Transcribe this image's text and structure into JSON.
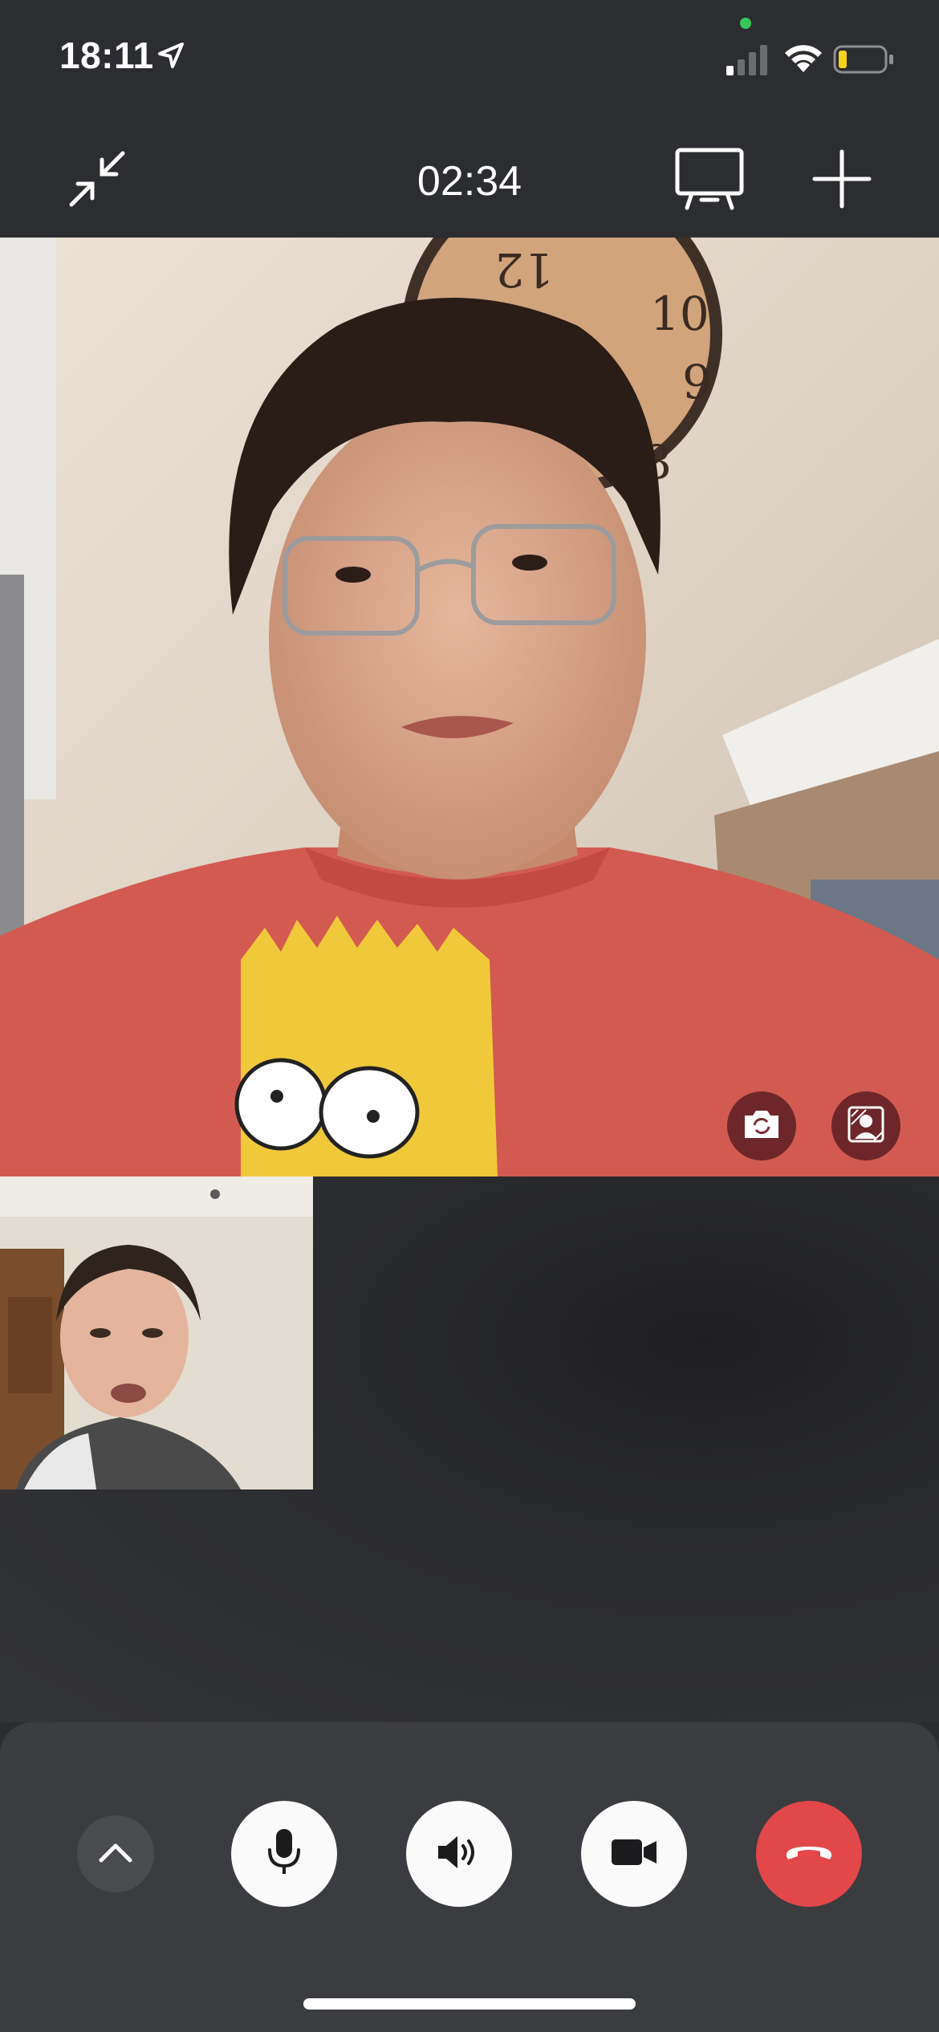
{
  "status_bar": {
    "time": "18:11",
    "location_icon": "location-arrow-icon",
    "signal_icon": "cellular-signal-icon",
    "wifi_icon": "wifi-icon",
    "battery_icon": "battery-low-icon",
    "battery_level": 0.15,
    "camera_in_use_indicator_color": "#35c759"
  },
  "header": {
    "call_duration": "02:34",
    "minimize_icon": "minimize-arrows-icon",
    "screen_share_icon": "screen-share-icon",
    "add_participant_icon": "plus-icon"
  },
  "main_video": {
    "flip_camera_icon": "camera-flip-icon",
    "portrait_effect_icon": "portrait-effect-icon"
  },
  "controls": {
    "more_icon": "chevron-up-icon",
    "mic_icon": "microphone-icon",
    "speaker_icon": "speaker-icon",
    "camera_icon": "video-camera-icon",
    "end_call_icon": "end-call-icon",
    "end_call_color": "#e2474a"
  }
}
